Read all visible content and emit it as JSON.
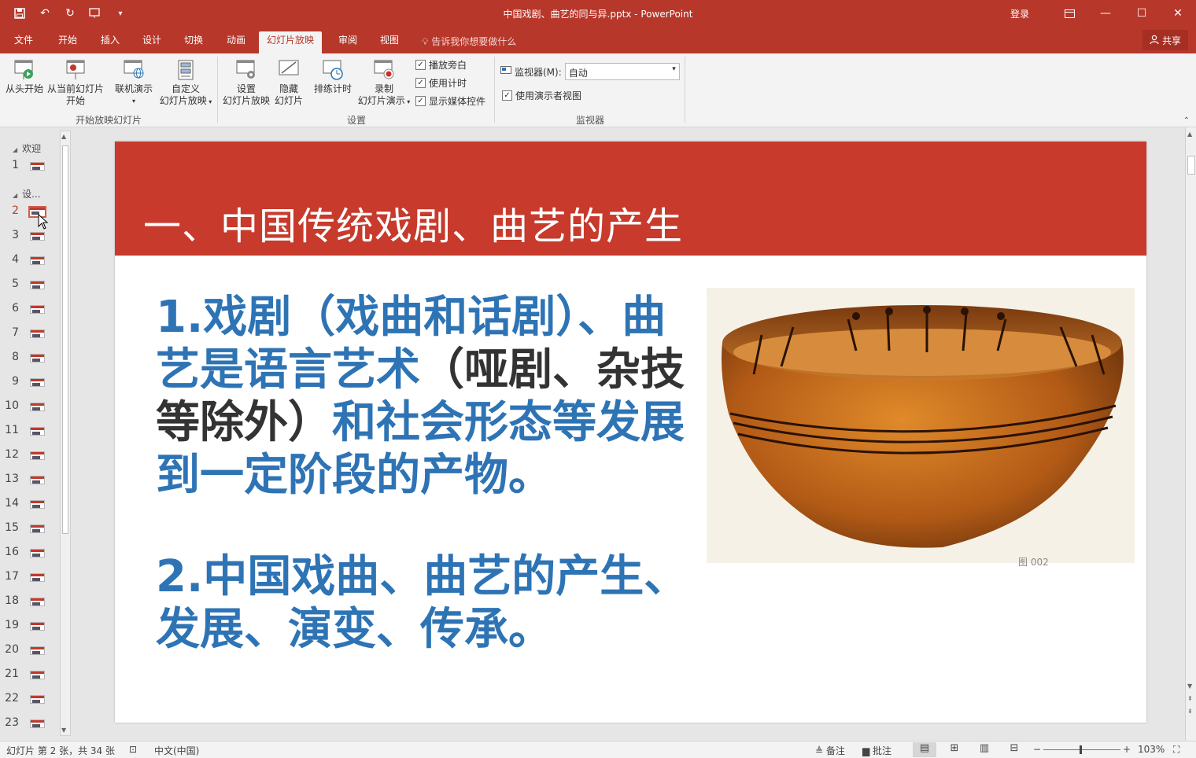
{
  "window": {
    "title": "中国戏剧、曲艺的同与异.pptx - PowerPoint",
    "login": "登录"
  },
  "ribbon_tabs": [
    {
      "label": "文件",
      "active": false
    },
    {
      "label": "开始",
      "active": false
    },
    {
      "label": "插入",
      "active": false
    },
    {
      "label": "设计",
      "active": false
    },
    {
      "label": "切换",
      "active": false
    },
    {
      "label": "动画",
      "active": false
    },
    {
      "label": "幻灯片放映",
      "active": true
    },
    {
      "label": "审阅",
      "active": false
    },
    {
      "label": "视图",
      "active": false
    }
  ],
  "tell_me": "告诉我你想要做什么",
  "share": "共享",
  "ribbon": {
    "start_group": {
      "from_beginning": "从头开始",
      "from_current_1": "从当前幻灯片",
      "from_current_2": "开始",
      "online_1": "联机演示",
      "custom_1": "自定义",
      "custom_2": "幻灯片放映",
      "label": "开始放映幻灯片"
    },
    "setup_group": {
      "setup_1": "设置",
      "setup_2": "幻灯片放映",
      "hide_1": "隐藏",
      "hide_2": "幻灯片",
      "rehearse": "排练计时",
      "record_1": "录制",
      "record_2": "幻灯片演示",
      "play_narration": "播放旁白",
      "use_timings": "使用计时",
      "show_media": "显示媒体控件",
      "label": "设置"
    },
    "monitor_group": {
      "monitor_label": "监视器(M):",
      "monitor_value": "自动",
      "presenter_view": "使用演示者视图",
      "label": "监视器"
    }
  },
  "thumbnails": {
    "sections": [
      {
        "name": "欢迎"
      },
      {
        "name": "设..."
      }
    ],
    "slides": [
      "1",
      "2",
      "3",
      "4",
      "5",
      "6",
      "7",
      "8",
      "9",
      "10",
      "11",
      "12",
      "13",
      "14",
      "15",
      "16",
      "17",
      "18",
      "19",
      "20",
      "21",
      "22",
      "23"
    ],
    "active": "2"
  },
  "slide": {
    "title": "一、中国传统戏剧、曲艺的产生",
    "p1_a": "1.戏剧（戏曲和话剧）、曲艺是语言艺术",
    "p1_b": "（哑剧、杂技等除外）",
    "p1_c": "和社会形态等发展到一定阶段的产物。",
    "p2": "2.中国戏曲、曲艺的产生、发展、演变、传承。",
    "photo_caption": "图 002"
  },
  "status": {
    "slide_info": "幻灯片 第 2 张，共 34 张",
    "language": "中文(中国)",
    "notes": "备注",
    "comments": "批注",
    "zoom": "103%"
  },
  "colors": {
    "accent": "#b7372a",
    "slide_band": "#c73a2c",
    "body_blue": "#2e74b5",
    "body_dark": "#333333"
  }
}
